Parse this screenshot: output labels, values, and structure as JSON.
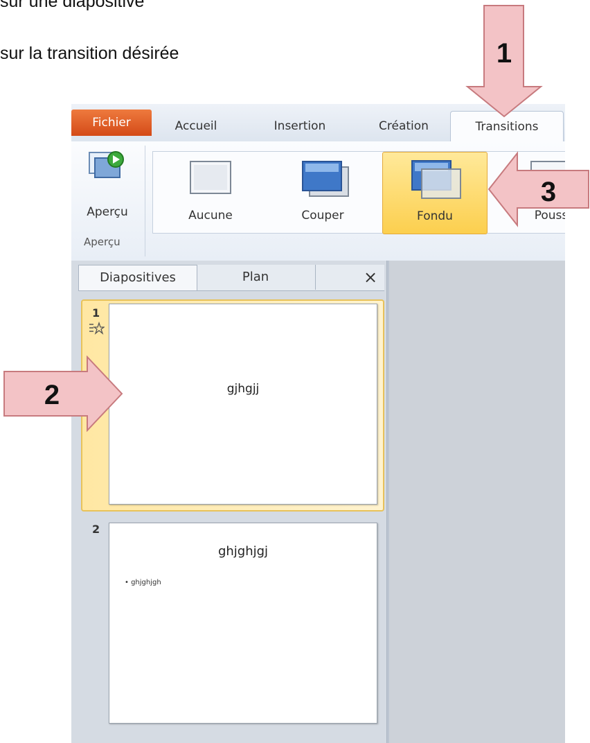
{
  "instructions": {
    "line1": "sur une diapositive",
    "line2": "sur la transition désirée"
  },
  "ribbon": {
    "tabs": [
      "Fichier",
      "Accueil",
      "Insertion",
      "Création",
      "Transitions"
    ],
    "preview_button_label": "Aperçu",
    "preview_group_label": "Aperçu",
    "transitions": [
      "Aucune",
      "Couper",
      "Fondu",
      "Pouss"
    ]
  },
  "slides_panel": {
    "tabs": [
      "Diapositives",
      "Plan"
    ],
    "close_glyph": "×",
    "slides": [
      {
        "number": "1",
        "title": "gjhgjj"
      },
      {
        "number": "2",
        "title": "ghjghjgj",
        "bullet": "ghjghjgh"
      }
    ]
  },
  "callouts": [
    "1",
    "2",
    "3"
  ],
  "colors": {
    "file_tab": "#d44a17",
    "selected": "#fccf4e",
    "arrow_fill": "#f3c3c6",
    "arrow_stroke": "#c77a7e"
  }
}
